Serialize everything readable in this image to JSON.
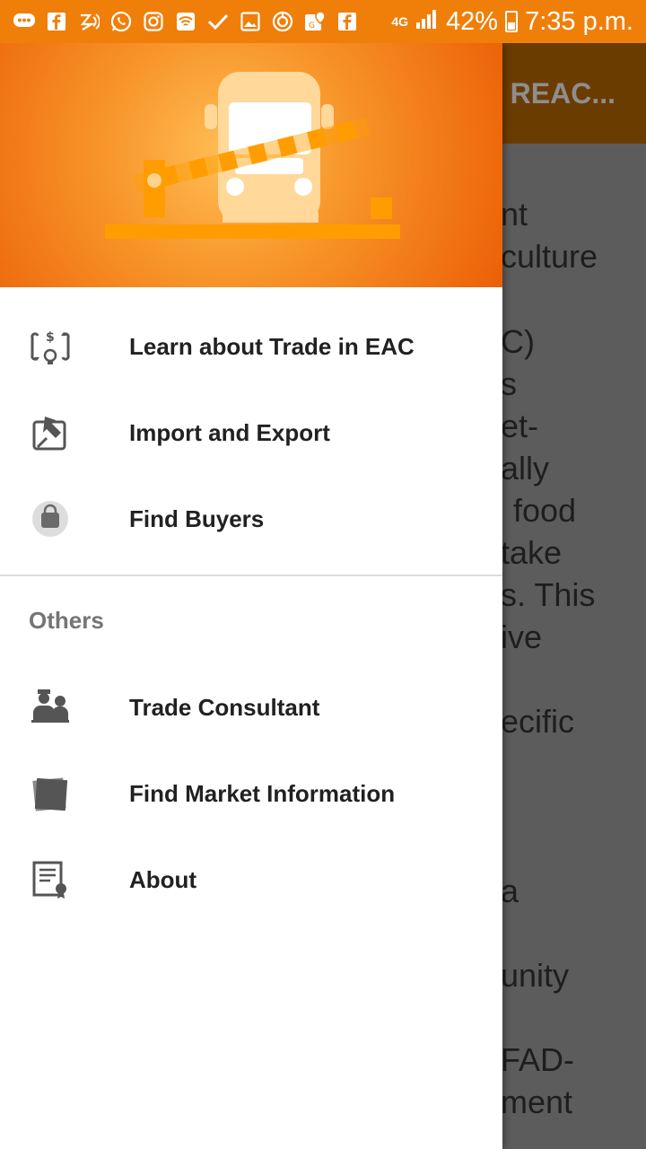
{
  "status_bar": {
    "network": "4G",
    "battery": "42%",
    "time": "7:35 p.m.",
    "icons": [
      "messages-icon",
      "facebook-icon",
      "nfc-icon",
      "whatsapp-icon",
      "instagram-icon",
      "wifi-icon",
      "check-icon",
      "gallery-icon",
      "sync-icon",
      "maps-icon",
      "facebook-icon",
      "signal-icon",
      "battery-icon"
    ]
  },
  "app": {
    "toolbar_title": "D REAC...",
    "content_lines": [
      "nt",
      "culture",
      "C)",
      "s",
      "et-",
      "ally",
      "food",
      "take",
      "s. This",
      "ive",
      "ecific",
      "a",
      "unity",
      "FAD-",
      "ment"
    ]
  },
  "drawer": {
    "header_image": "truck-at-border-gate-illustration",
    "primary_items": [
      {
        "label": "Learn about Trade in EAC",
        "icon": "trade-cycle-icon"
      },
      {
        "label": "Import and Export",
        "icon": "import-export-icon"
      },
      {
        "label": "Find Buyers",
        "icon": "shopping-bag-icon"
      }
    ],
    "section_title": "Others",
    "other_items": [
      {
        "label": "Trade Consultant",
        "icon": "consultant-icon"
      },
      {
        "label": "Find Market Information",
        "icon": "market-info-icon"
      },
      {
        "label": "About",
        "icon": "certificate-icon"
      }
    ]
  },
  "colors": {
    "status_bar": "#f07f0a",
    "toolbar": "#6b3c00",
    "header_orange": "#f7952a",
    "gate_bar": "#ff9d00",
    "label_text": "#212121",
    "section_text": "#757575"
  }
}
